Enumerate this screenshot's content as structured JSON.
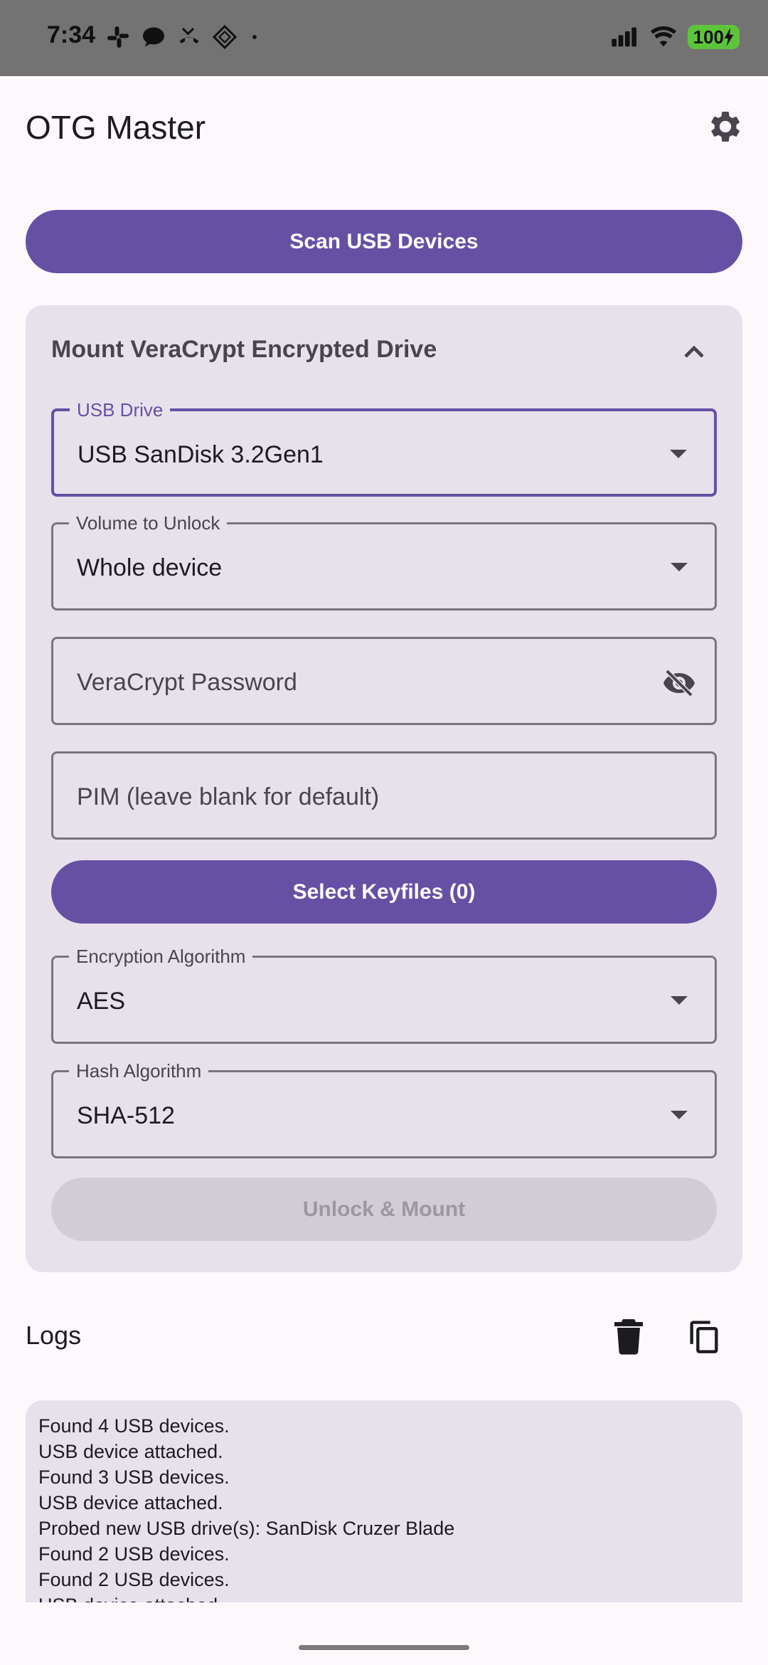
{
  "status_bar": {
    "time": "7:34",
    "battery": "100"
  },
  "app": {
    "title": "OTG Master"
  },
  "scan_button": "Scan USB Devices",
  "card": {
    "title": "Mount VeraCrypt Encrypted Drive",
    "usb_drive": {
      "label": "USB Drive",
      "value": "USB SanDisk 3.2Gen1"
    },
    "volume": {
      "label": "Volume to Unlock",
      "value": "Whole device"
    },
    "password": {
      "placeholder": "VeraCrypt Password"
    },
    "pim": {
      "placeholder": "PIM (leave blank for default)"
    },
    "keyfiles_button": "Select Keyfiles (0)",
    "encryption": {
      "label": "Encryption Algorithm",
      "value": "AES"
    },
    "hash": {
      "label": "Hash Algorithm",
      "value": "SHA-512"
    },
    "unlock_button": "Unlock & Mount"
  },
  "logs": {
    "title": "Logs",
    "lines": [
      "Found 4 USB devices.",
      "USB device attached.",
      "Found 3 USB devices.",
      "USB device attached.",
      "Probed new USB drive(s): SanDisk Cruzer Blade",
      "Found 2 USB devices.",
      "Found 2 USB devices.",
      "USB device attached."
    ]
  },
  "colors": {
    "primary": "#6650A4",
    "card_bg": "#E7E1EB",
    "page_bg": "#FDF8FC",
    "disabled_bg": "#D2CCD6"
  }
}
